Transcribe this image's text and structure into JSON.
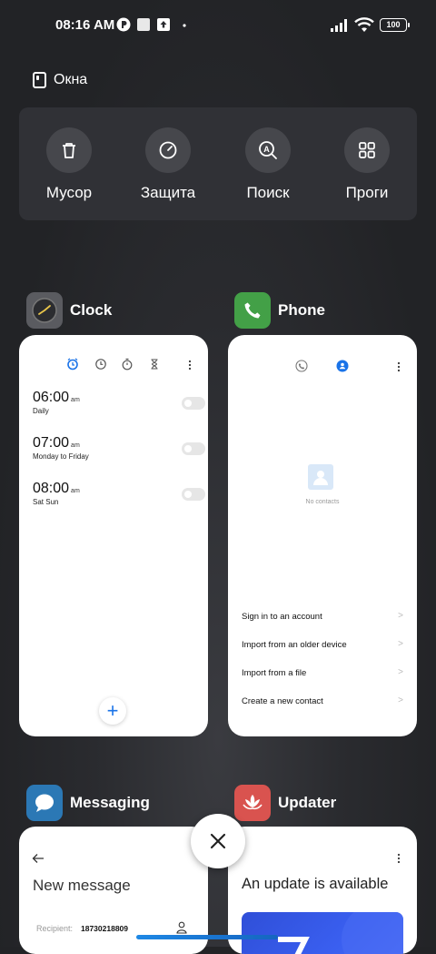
{
  "status_bar": {
    "time": "08:16 AM",
    "battery": "100"
  },
  "windows_label": "Окна",
  "tools": [
    {
      "label": "Мусор",
      "icon": "trash-icon"
    },
    {
      "label": "Защита",
      "icon": "shield-gauge-icon"
    },
    {
      "label": "Поиск",
      "icon": "search-icon"
    },
    {
      "label": "Проги",
      "icon": "apps-grid-icon"
    }
  ],
  "apps": {
    "clock": {
      "name": "Clock",
      "alarms": [
        {
          "time": "06:00",
          "ampm": "am",
          "days": "Daily"
        },
        {
          "time": "07:00",
          "ampm": "am",
          "days": "Monday to Friday"
        },
        {
          "time": "08:00",
          "ampm": "am",
          "days": "Sat Sun"
        }
      ]
    },
    "phone": {
      "name": "Phone",
      "empty_text": "No contacts",
      "links": [
        "Sign in to an account",
        "Import from an older device",
        "Import from a file",
        "Create a new contact"
      ]
    },
    "messaging": {
      "name": "Messaging",
      "title": "New message",
      "recipient_label": "Recipient:",
      "recipient_value": "18730218809"
    },
    "updater": {
      "name": "Updater",
      "title": "An update is available"
    }
  },
  "colors": {
    "accent": "#1a73e8",
    "phone_icon_bg": "#43a047",
    "messaging_icon_bg": "#2b78b5",
    "updater_icon_bg": "#d9534f"
  }
}
